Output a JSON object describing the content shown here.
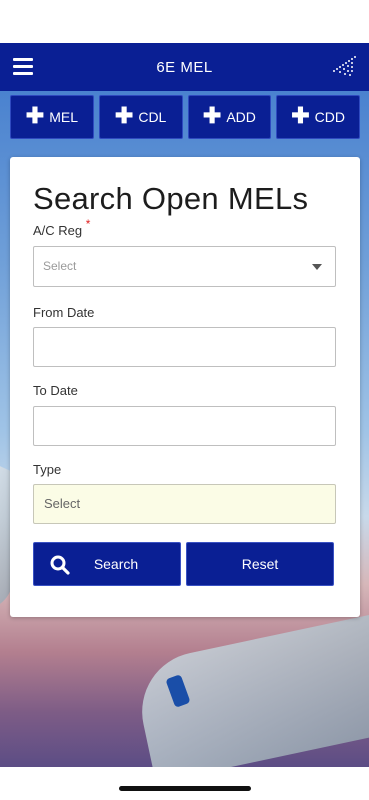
{
  "app": {
    "title": "6E MEL"
  },
  "icons": {
    "menu": "hamburger-icon",
    "logo": "plane-dots-icon",
    "add": "plus-icon",
    "search": "search-icon",
    "dropdown": "chevron-down-icon"
  },
  "quick_actions": [
    {
      "label": "MEL"
    },
    {
      "label": "CDL"
    },
    {
      "label": "ADD"
    },
    {
      "label": "CDD"
    }
  ],
  "form": {
    "title": "Search Open MELs",
    "ac_reg": {
      "label": "A/C Reg",
      "required_mark": "*",
      "selected": "Select"
    },
    "from_date": {
      "label": "From Date",
      "value": ""
    },
    "to_date": {
      "label": "To Date",
      "value": ""
    },
    "type": {
      "label": "Type",
      "selected": "Select"
    },
    "search_label": "Search",
    "reset_label": "Reset"
  },
  "colors": {
    "primary": "#0a1f94",
    "required": "#e02020",
    "type_field_bg": "#fbfce6"
  }
}
